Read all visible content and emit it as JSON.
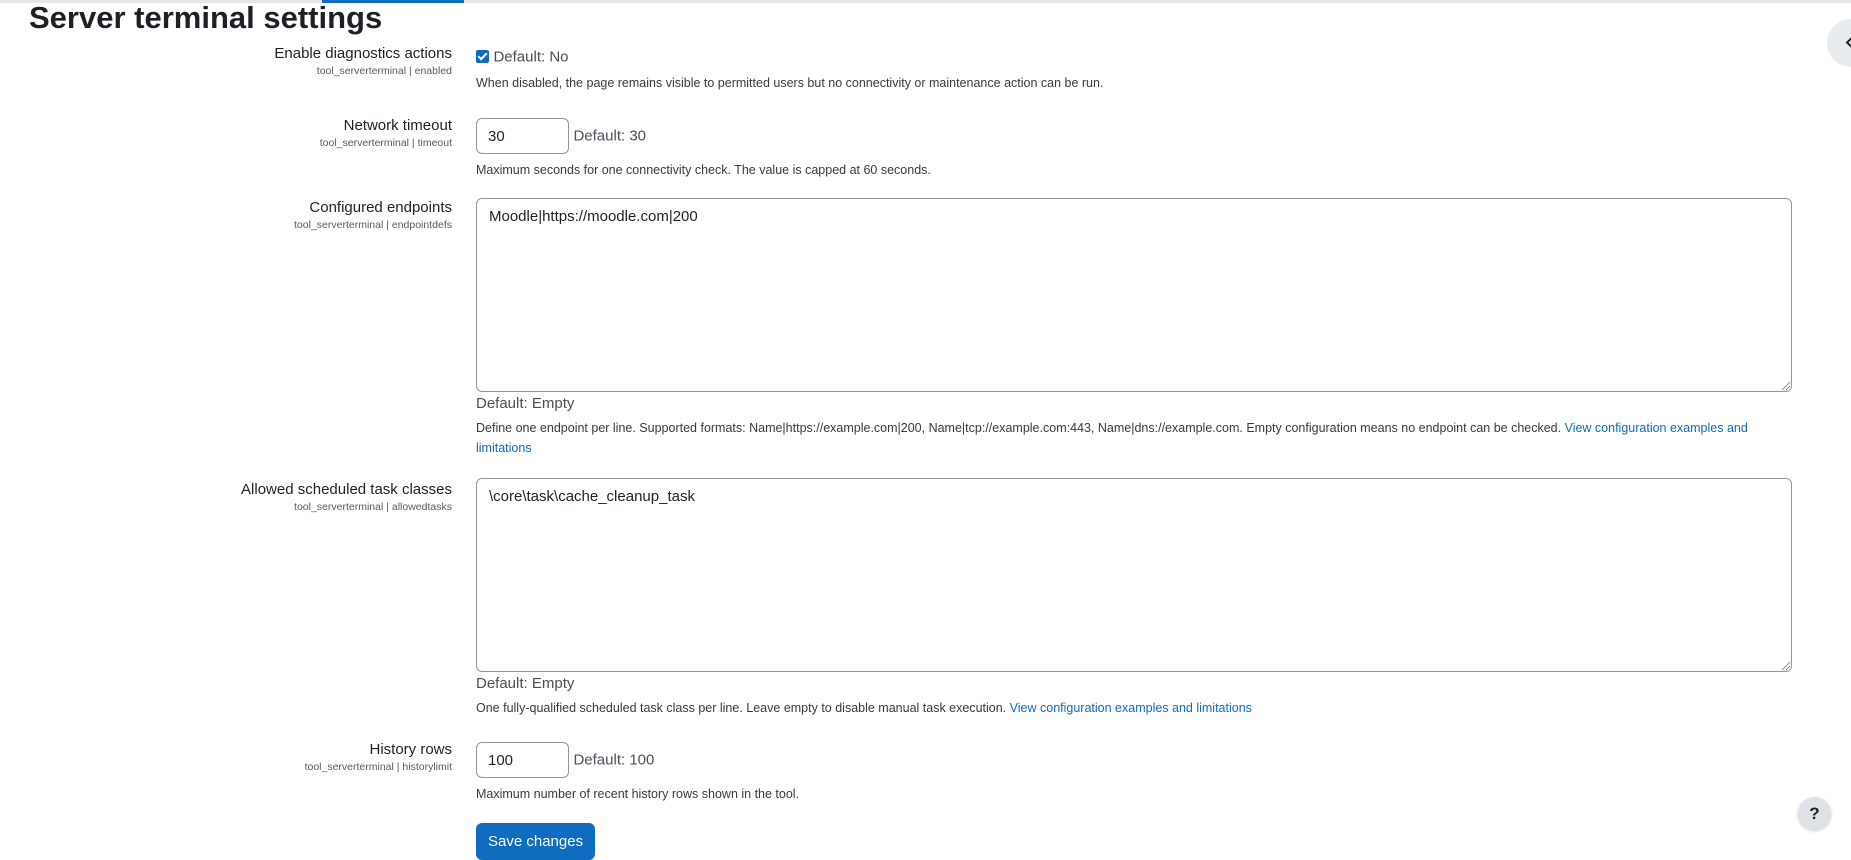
{
  "page": {
    "title": "Server terminal settings"
  },
  "settings": {
    "enabled": {
      "label": "Enable diagnostics actions",
      "key": "tool_serverterminal | enabled",
      "checked": true,
      "default": "Default: No",
      "description": "When disabled, the page remains visible to permitted users but no connectivity or maintenance action can be run."
    },
    "timeout": {
      "label": "Network timeout",
      "key": "tool_serverterminal | timeout",
      "value": "30",
      "default": "Default: 30",
      "description": "Maximum seconds for one connectivity check. The value is capped at 60 seconds."
    },
    "endpointdefs": {
      "label": "Configured endpoints",
      "key": "tool_serverterminal | endpointdefs",
      "value": "Moodle|https://moodle.com|200",
      "default": "Default: Empty",
      "description": "Define one endpoint per line. Supported formats: Name|https://example.com|200, Name|tcp://example.com:443, Name|dns://example.com. Empty configuration means no endpoint can be checked.",
      "link": "View configuration examples and limitations"
    },
    "allowedtasks": {
      "label": "Allowed scheduled task classes",
      "key": "tool_serverterminal | allowedtasks",
      "value": "\\core\\task\\cache_cleanup_task",
      "default": "Default: Empty",
      "description": "One fully-qualified scheduled task class per line. Leave empty to disable manual task execution.",
      "link": "View configuration examples and limitations"
    },
    "historylimit": {
      "label": "History rows",
      "key": "tool_serverterminal | historylimit",
      "value": "100",
      "default": "Default: 100",
      "description": "Maximum number of recent history rows shown in the tool."
    }
  },
  "actions": {
    "save_label": "Save changes",
    "help_label": "?"
  },
  "colors": {
    "accent": "#0f6cbf"
  },
  "icons": {
    "drawer": "chevron-left-icon",
    "help": "question-icon",
    "checkbox": "check-icon"
  }
}
